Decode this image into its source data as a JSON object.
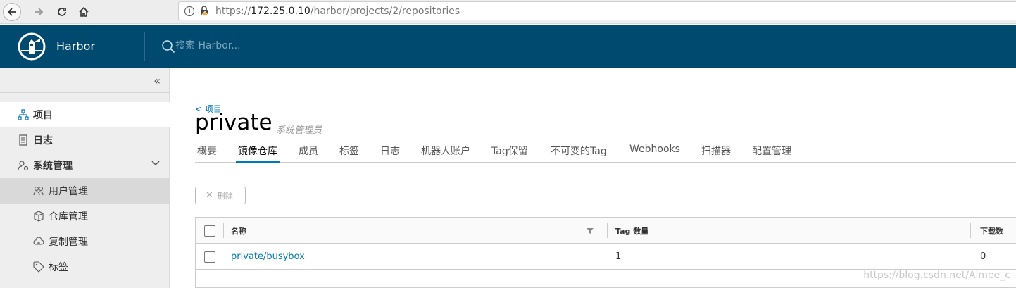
{
  "browser": {
    "url_scheme": "https://",
    "url_host": "172.25.0.10",
    "url_path": "/harbor/projects/2/repositories"
  },
  "header": {
    "brand": "Harbor",
    "search_placeholder": "搜索 Harbor..."
  },
  "sidebar": {
    "items": [
      {
        "label": "项目",
        "icon": "projects-icon"
      },
      {
        "label": "日志",
        "icon": "log-icon"
      },
      {
        "label": "系统管理",
        "icon": "admin-icon"
      }
    ],
    "sub_items": [
      {
        "label": "用户管理",
        "icon": "users-icon"
      },
      {
        "label": "仓库管理",
        "icon": "registry-icon"
      },
      {
        "label": "复制管理",
        "icon": "replication-icon"
      },
      {
        "label": "标签",
        "icon": "tag-icon"
      }
    ]
  },
  "main": {
    "breadcrumb": "< 项目",
    "project_name": "private",
    "role": "系统管理员",
    "tabs": [
      "概要",
      "镜像仓库",
      "成员",
      "标签",
      "日志",
      "机器人账户",
      "Tag保留",
      "不可变的Tag",
      "Webhooks",
      "扫描器",
      "配置管理"
    ],
    "active_tab": "镜像仓库",
    "delete_label": "删除",
    "columns": [
      "名称",
      "Tag 数量",
      "下载数"
    ],
    "rows": [
      {
        "name": "private/busybox",
        "tags": "1",
        "pulls": "0"
      }
    ]
  },
  "watermark": "https://blog.csdn.net/Aimee_c",
  "colors": {
    "header": "#004a70",
    "accent": "#0079b8"
  }
}
